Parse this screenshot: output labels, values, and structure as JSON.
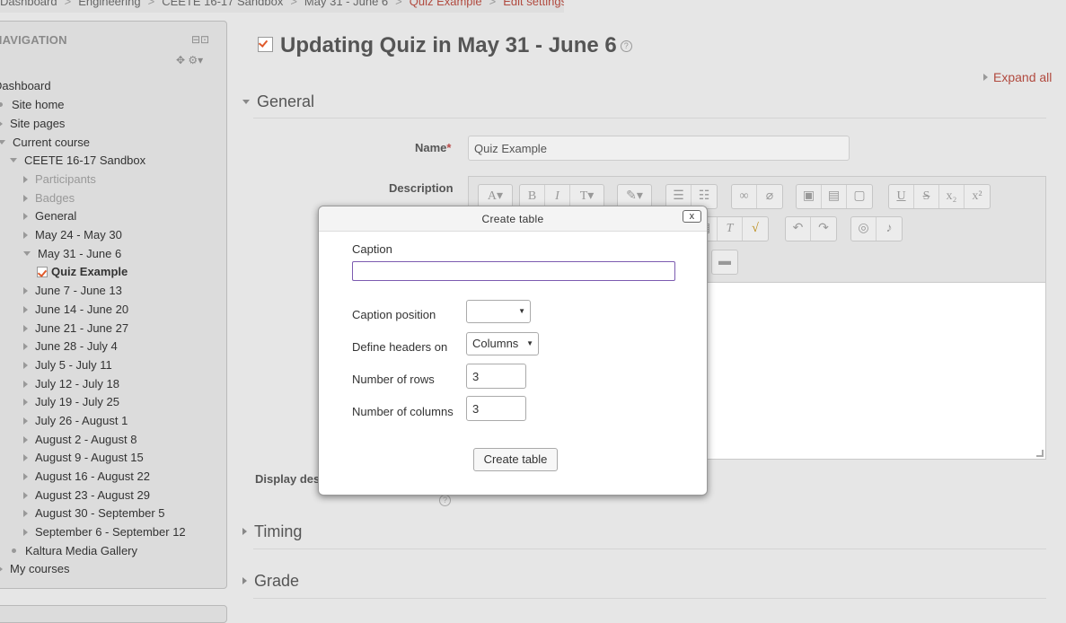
{
  "breadcrumb": {
    "items": [
      "Dashboard",
      "Engineering",
      "CEETE 16-17 Sandbox",
      "May 31 - June 6",
      "Quiz Example",
      "Edit settings"
    ],
    "separator": ">"
  },
  "navigation": {
    "title": "NAVIGATION",
    "dashboard": "Dashboard",
    "site_home": "Site home",
    "site_pages": "Site pages",
    "current_course": "Current course",
    "course_name": "CEETE 16-17 Sandbox",
    "participants": "Participants",
    "badges": "Badges",
    "general": "General",
    "weeks": [
      "May 24 - May 30",
      "May 31 - June 6",
      "June 7 - June 13",
      "June 14 - June 20",
      "June 21 - June 27",
      "June 28 - July 4",
      "July 5 - July 11",
      "July 12 - July 18",
      "July 19 - July 25",
      "July 26 - August 1",
      "August 2 - August 8",
      "August 9 - August 15",
      "August 16 - August 22",
      "August 23 - August 29",
      "August 30 - September 5",
      "September 6 - September 12"
    ],
    "quiz_example": "Quiz Example",
    "kaltura": "Kaltura Media Gallery",
    "my_courses": "My courses"
  },
  "page": {
    "title": "Updating Quiz in May 31 - June 6",
    "expand_all": "Expand all"
  },
  "form": {
    "general_section": "General",
    "name_label": "Name",
    "name_required": "*",
    "name_value": "Quiz Example",
    "description_label": "Description",
    "display_description_label": "Display des",
    "timing_section": "Timing",
    "grade_section": "Grade"
  },
  "modal": {
    "title": "Create table",
    "close": "x",
    "caption_label": "Caption",
    "caption_value": "",
    "caption_position_label": "Caption position",
    "caption_position_value": "",
    "headers_label": "Define headers on",
    "headers_value": "Columns",
    "rows_label": "Number of rows",
    "rows_value": "3",
    "columns_label": "Number of columns",
    "columns_value": "3",
    "create_button": "Create table"
  },
  "colors": {
    "link": "#b14a3f",
    "background": "#e6e6e6",
    "focus_border": "#7c5bb0"
  }
}
